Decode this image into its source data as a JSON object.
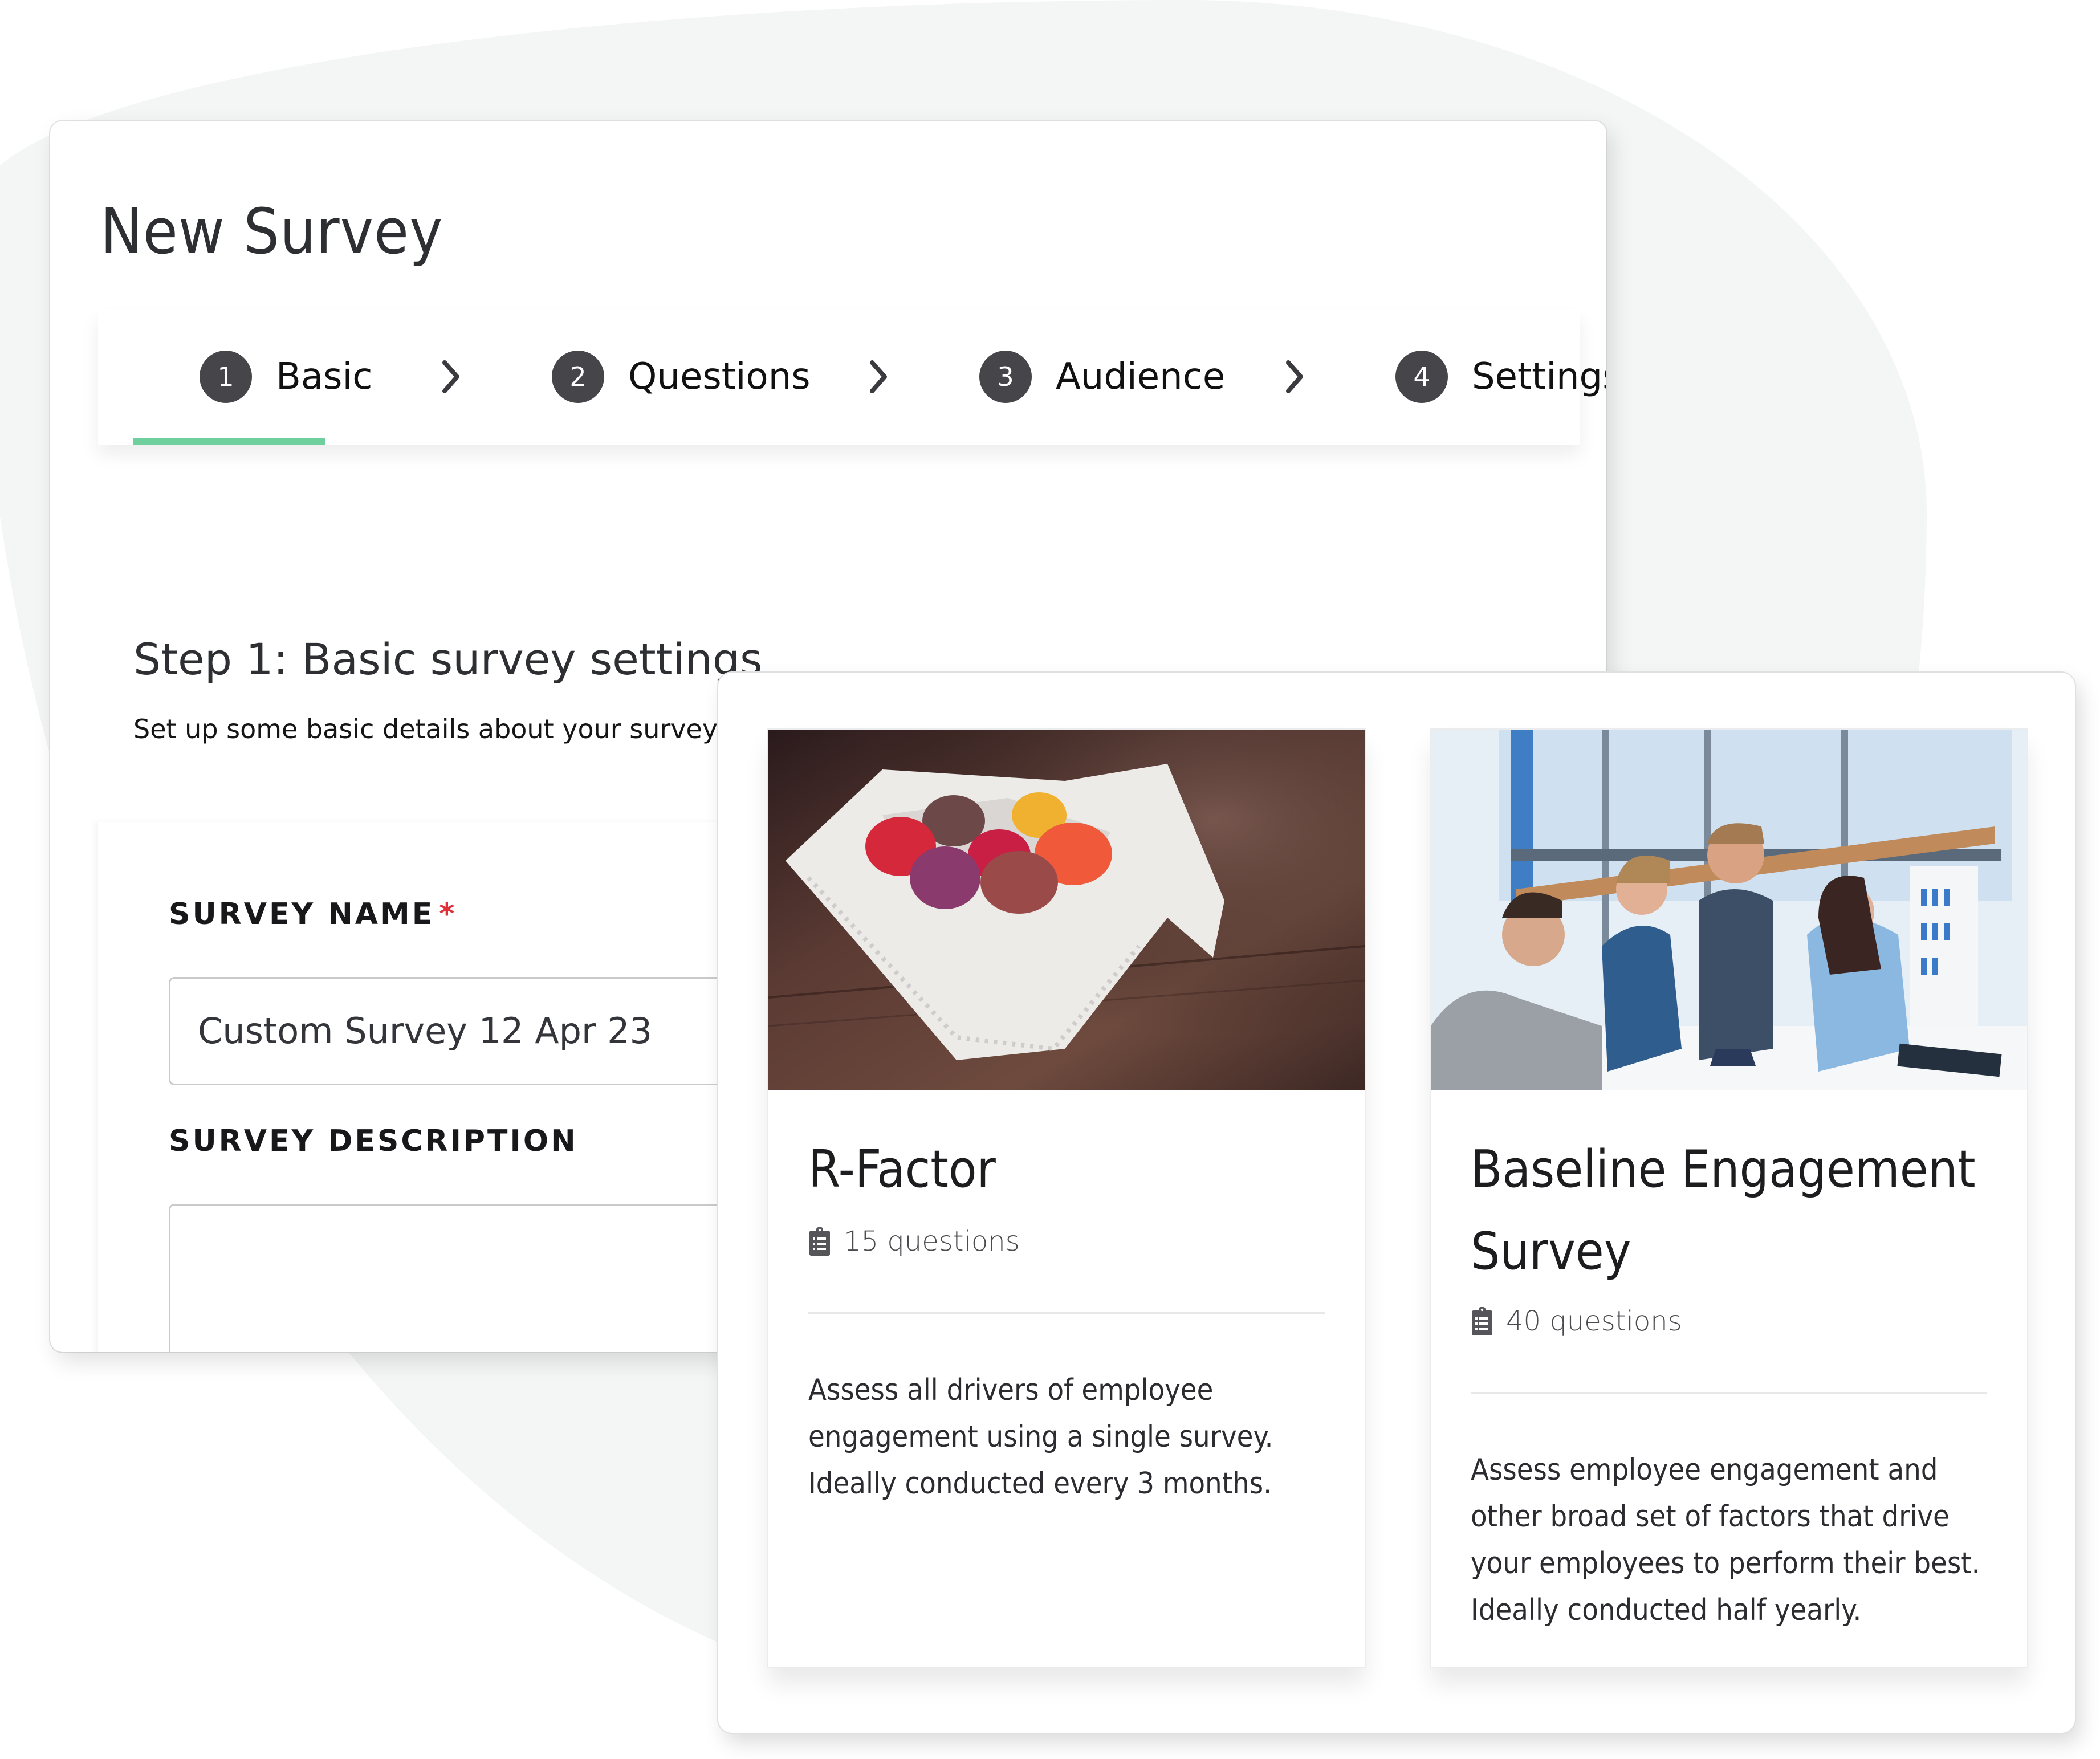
{
  "page": {
    "title": "New Survey"
  },
  "stepper": {
    "steps": [
      {
        "number": "1",
        "label": "Basic",
        "active": true
      },
      {
        "number": "2",
        "label": "Questions",
        "active": false
      },
      {
        "number": "3",
        "label": "Audience",
        "active": false
      },
      {
        "number": "4",
        "label": "Settings",
        "active": false
      }
    ],
    "active_color": "#6fcf9d"
  },
  "section": {
    "title": "Step 1: Basic survey settings",
    "subtitle": "Set up some basic details about your survey"
  },
  "form": {
    "name_label": "SURVEY NAME",
    "required_marker": "*",
    "name_value": "Custom Survey 12 Apr 23",
    "description_label": "SURVEY DESCRIPTION",
    "description_value": ""
  },
  "templates": [
    {
      "title": "R-Factor",
      "icon": "clipboard-list-icon",
      "question_count": "15 questions",
      "description": "Assess all drivers of employee engagement using a single survey. Ideally conducted every 3 months.",
      "image": "macarons-in-napkin-photo"
    },
    {
      "title": "Baseline Engagement Survey",
      "icon": "clipboard-list-icon",
      "question_count": "40 questions",
      "description": "Assess employee engagement and other broad set of factors that drive your employees to perform their best. Ideally conducted half yearly.",
      "image": "team-meeting-photo"
    }
  ]
}
